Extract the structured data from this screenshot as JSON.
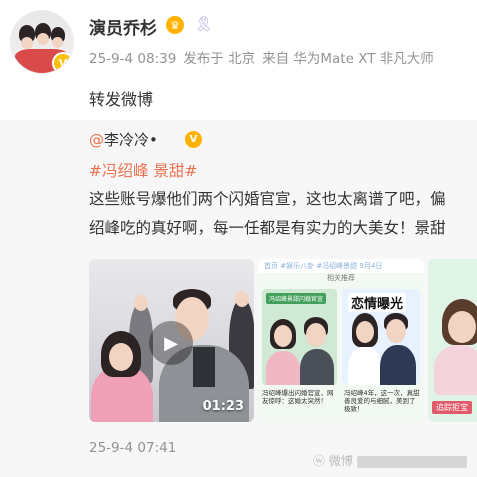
{
  "post": {
    "author": "演员乔杉",
    "meta": {
      "time": "25-9-4 08:39",
      "location": "发布于 北京",
      "source": "来自 华为Mate XT 非凡大师"
    },
    "text": "转发微博"
  },
  "repost": {
    "author_at": "@",
    "author": "李冷冷•",
    "topic": "#冯绍峰 景甜#",
    "lines": [
      "这些账号爆他们两个闪婚官宣，这也太离谱了吧，偏",
      "绍峰吃的真好啊，每一任都是有实力的大美女！景甜"
    ],
    "video_duration": "01:23",
    "time": "25-9-4 07:41"
  },
  "thumb2": {
    "header": "首页  #娱乐八卦  #冯绍峰景甜  9月4日",
    "subheader": "相关推荐",
    "panel_text": "恋情曝光",
    "left_title": "冯绍峰景甜闪婚官宣",
    "left_caption": "冯绍峰爆出闪婚官宣，网友惊呼：这婚太突然！",
    "right_caption": "冯绍峰4年，这一次，真甜善良爱的与细腻，美到了极致！"
  },
  "thumb3": {
    "label": "追踪拒宝"
  },
  "watermark": {
    "site": "微博"
  },
  "colors": {
    "accent": "#eb7350",
    "meta": "#939393",
    "repost_bg": "#f7f7f7",
    "badge": "#ffb300"
  }
}
